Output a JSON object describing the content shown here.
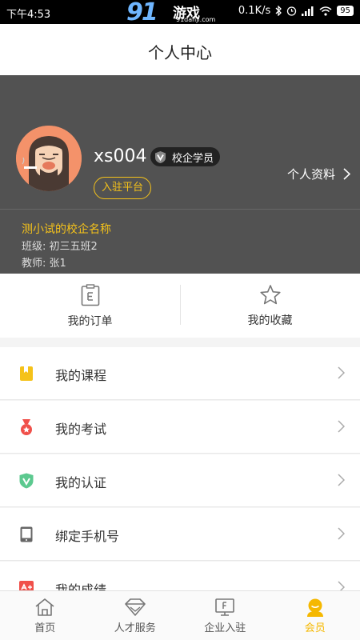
{
  "status_bar": {
    "time": "下午4:53",
    "network_speed": "0.1K/s",
    "battery": "95",
    "watermark": {
      "big": "91",
      "cn": "游戏",
      "url": "91danji.com"
    }
  },
  "header": {
    "title": "个人中心"
  },
  "profile": {
    "username": "xs004",
    "role_badge": "校企学员",
    "join_button": "入驻平台",
    "profile_link": "个人资料",
    "school_name": "测小试的校企名称",
    "class_info": "班级: 初三五班2",
    "teacher_info": "教师: 张1"
  },
  "quick_actions": [
    {
      "label": "我的订单",
      "icon": "clipboard-icon"
    },
    {
      "label": "我的收藏",
      "icon": "star-icon"
    }
  ],
  "menu": [
    {
      "label": "我的课程",
      "icon": "bookmark-book-icon",
      "color": "#f5c21a"
    },
    {
      "label": "我的考试",
      "icon": "medal-icon",
      "color": "#f0504a"
    },
    {
      "label": "我的认证",
      "icon": "shield-check-icon",
      "color": "#5cc98f"
    },
    {
      "label": "绑定手机号",
      "icon": "phone-icon",
      "color": "#666666"
    },
    {
      "label": "我的成绩",
      "icon": "grade-icon",
      "color": "#f0504a"
    }
  ],
  "tabbar": [
    {
      "label": "首页",
      "icon": "home-icon",
      "active": false
    },
    {
      "label": "人才服务",
      "icon": "diamond-icon",
      "active": false
    },
    {
      "label": "企业入驻",
      "icon": "enterprise-icon",
      "active": false
    },
    {
      "label": "会员",
      "icon": "member-icon",
      "active": true
    }
  ],
  "colors": {
    "accent": "#f5c21a",
    "profile_bg": "#525252",
    "active_tab": "#f5b800"
  }
}
